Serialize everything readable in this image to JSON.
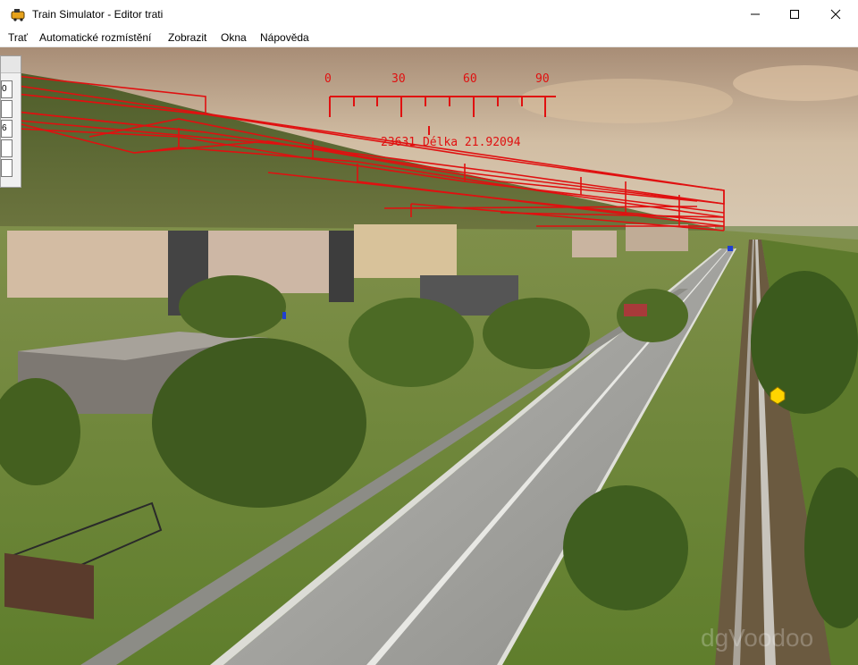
{
  "window": {
    "title": "Train Simulator - Editor trati",
    "app_icon": "train-icon",
    "controls": [
      "minimize-icon",
      "maximize-icon",
      "close-icon"
    ]
  },
  "menu": {
    "items": [
      "Trať",
      "Automatické rozmístění",
      "Zobrazit",
      "Okna",
      "Nápověda"
    ]
  },
  "side_panel": {
    "field_1": "0",
    "field_2": "6"
  },
  "hud": {
    "compass_ticks": [
      "0",
      "30",
      "60",
      "90"
    ],
    "status_text": "23631 Délka 21.92094"
  },
  "watermark": "dgVoodoo",
  "colors": {
    "hud_red": "#e01010",
    "sky": "#cdb59b",
    "grass": "#6f8a3a",
    "road": "#9a9a96",
    "marker_yellow": "#ffd400"
  }
}
